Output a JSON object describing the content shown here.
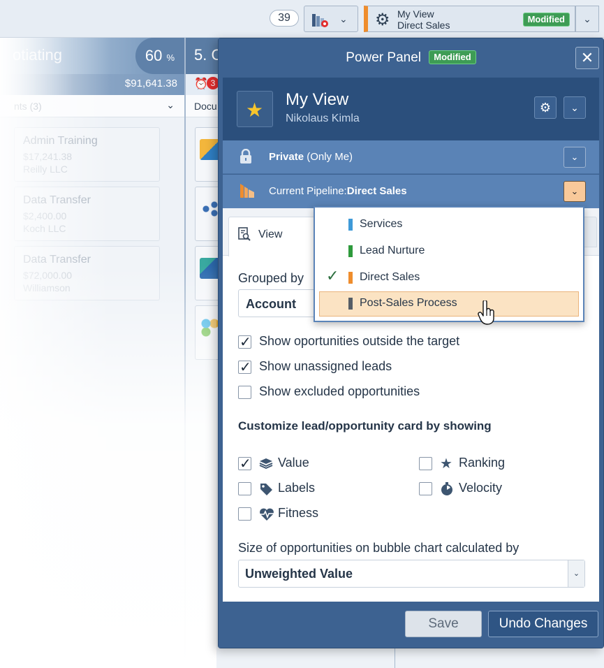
{
  "header": {
    "count": "39",
    "view_title": "My View",
    "view_sub": "Direct Sales",
    "view_badge": "Modified"
  },
  "board": {
    "col1": {
      "name": "otiating",
      "percent": "60",
      "percent_unit": "%",
      "amount": "$91,641.38",
      "filter": "nts (3)"
    },
    "col2": {
      "name": "5. C",
      "alert_count": "3",
      "filter": "Docu"
    },
    "cards": [
      {
        "title": "Admin Training",
        "value": "$17,241.38",
        "company": "Reilly LLC"
      },
      {
        "title": "Data Transfer",
        "value": "$2,400.00",
        "company": "Koch LLC"
      },
      {
        "title": "Data Transfer",
        "value": "$72,000.00",
        "company": "Williamson"
      }
    ]
  },
  "panel": {
    "title": "Power Panel",
    "badge": "Modified",
    "view_name": "My View",
    "user": "Nikolaus Kimla",
    "privacy_bold": "Private",
    "privacy_rest": " (Only Me)",
    "pipeline_prefix": "Current Pipeline:",
    "pipeline_value": "Direct Sales",
    "tab_view": "View",
    "grouped_label": "Grouped by",
    "grouped_value": "Account",
    "options": [
      {
        "label": "Show oportunities outside the target",
        "checked": true
      },
      {
        "label": "Show unassigned leads",
        "checked": true
      },
      {
        "label": "Show excluded opportunities",
        "checked": false
      }
    ],
    "card_section_title": "Customize lead/opportunity card by showing",
    "card_options": [
      {
        "label": "Value",
        "icon": "stack-icon",
        "checked": true
      },
      {
        "label": "Ranking",
        "icon": "star-icon",
        "checked": false
      },
      {
        "label": "Labels",
        "icon": "tag-icon",
        "checked": false
      },
      {
        "label": "Velocity",
        "icon": "velocity-icon",
        "checked": false
      },
      {
        "label": "Fitness",
        "icon": "heartbeat-icon",
        "checked": false
      }
    ],
    "size_label": "Size of opportunities on bubble chart calculated by",
    "size_value": "Unweighted Value",
    "save_label": "Save",
    "undo_label": "Undo Changes"
  },
  "dropdown": {
    "items": [
      {
        "label": "Services",
        "color": "#3f9ad8",
        "selected": false,
        "hover": false
      },
      {
        "label": "Lead Nurture",
        "color": "#2e9a3c",
        "selected": false,
        "hover": false
      },
      {
        "label": "Direct Sales",
        "color": "#ef8d2d",
        "selected": true,
        "hover": false
      },
      {
        "label": "Post-Sales Process",
        "color": "#555d66",
        "selected": false,
        "hover": true
      }
    ],
    "check_glyph": "✓"
  },
  "colors": {
    "panel": "#3d6291",
    "accent_orange": "#ef8d2d",
    "badge_green": "#3e9c55"
  }
}
